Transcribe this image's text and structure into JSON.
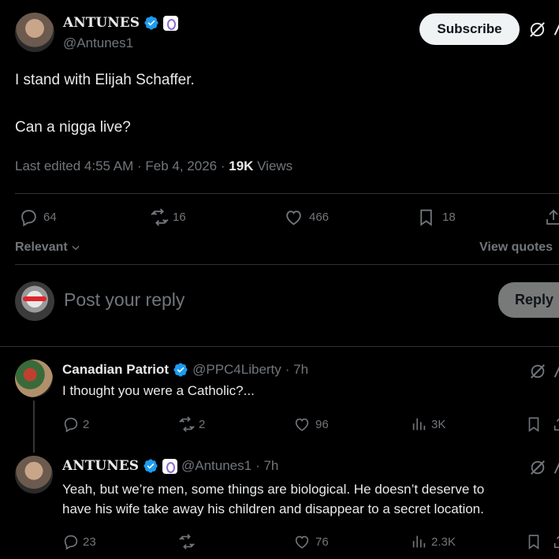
{
  "main_tweet": {
    "author_name": "ANTUNES",
    "handle": "@Antunes1",
    "subscribe_label": "Subscribe",
    "text_line1": "I stand with Elijah Schaffer.",
    "text_line2": "Can a nigga live?",
    "edited": "Last edited 4:55 AM · Feb 4, 2026 · ",
    "views_count": "19K",
    "views_label": " Views",
    "replies": "64",
    "reposts": "16",
    "likes": "466",
    "bookmarks": "18"
  },
  "sort": {
    "label": "Relevant",
    "view_quotes": "View quotes"
  },
  "composer": {
    "placeholder": "Post your reply",
    "reply_label": "Reply"
  },
  "replies": [
    {
      "author_name": "Canadian Patriot",
      "handle": "@PPC4Liberty",
      "time": "· 7h",
      "text": "I thought you were a Catholic?...",
      "replies": "2",
      "reposts": "2",
      "likes": "96",
      "views": "3K"
    },
    {
      "author_name": "ANTUNES",
      "handle": "@Antunes1",
      "time": "· 7h",
      "text_line1": "Yeah, but we’re men, some things are biological. He doesn’t deserve to",
      "text_line2": "have his wife take away his children and disappear to a secret location.",
      "replies": "23",
      "reposts": "",
      "likes": "76",
      "views": "2.3K"
    }
  ],
  "colors": {
    "background": "#000000",
    "text": "#e7e9ea",
    "muted": "#71767b",
    "verified": "#1d9bf0",
    "divider": "#2f3336"
  }
}
